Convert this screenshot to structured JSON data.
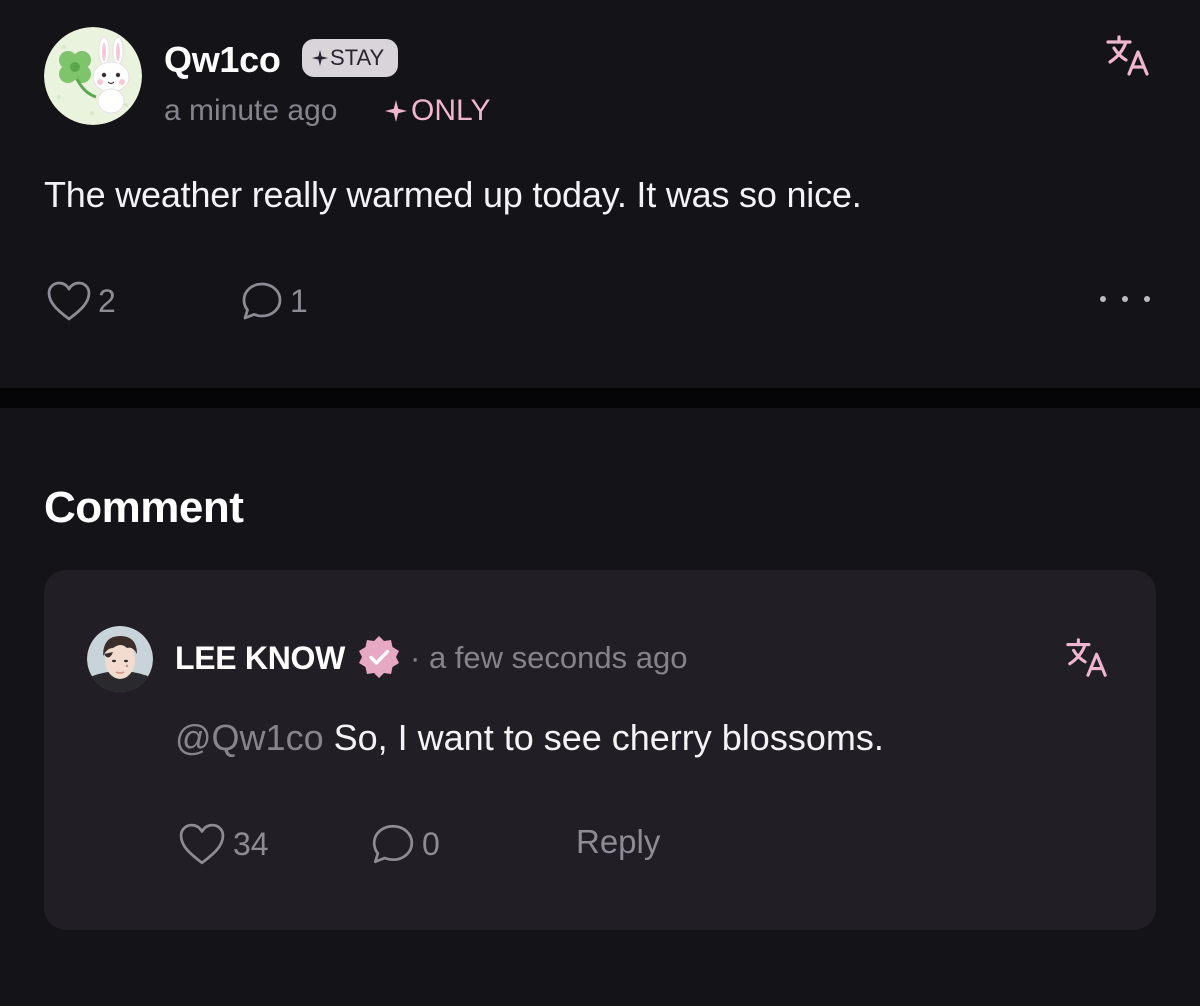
{
  "post": {
    "author": "Qw1co",
    "badge": "STAY",
    "time": "a minute ago",
    "visibility": "ONLY",
    "body": "The weather really warmed up today. It was so nice.",
    "likes": "2",
    "comments": "1"
  },
  "comments_section": {
    "title": "Comment",
    "items": [
      {
        "author": "LEE KNOW",
        "time_sep": "·",
        "time": "a few seconds ago",
        "mention": "@Qw1co",
        "text": "So, I want to see cherry blossoms.",
        "likes": "34",
        "replies": "0",
        "reply_label": "Reply"
      }
    ]
  },
  "colors": {
    "background": "#141318",
    "card": "#211f25",
    "accent_pink": "#f0b6cf",
    "muted_text": "#85838b"
  },
  "icons": {
    "translate": "translate-icon",
    "like": "heart-icon",
    "comment": "speech-bubble-icon",
    "more": "ellipsis-icon",
    "verified": "verified-badge-icon"
  }
}
